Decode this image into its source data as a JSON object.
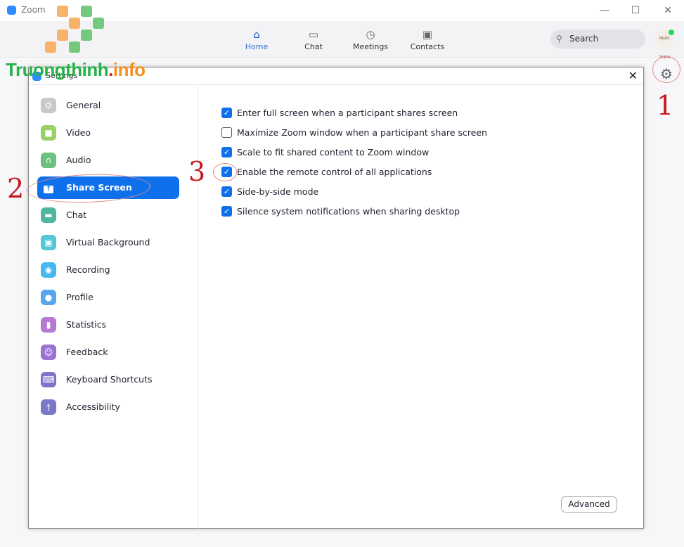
{
  "app": {
    "title": "Zoom",
    "window_controls": [
      "minimize",
      "maximize",
      "close"
    ]
  },
  "nav": {
    "tabs": [
      {
        "label": "Home",
        "icon": "home-icon",
        "active": true
      },
      {
        "label": "Chat",
        "icon": "chat-icon"
      },
      {
        "label": "Meetings",
        "icon": "clock-icon"
      },
      {
        "label": "Contacts",
        "icon": "contacts-icon"
      }
    ],
    "search_placeholder": "Search",
    "avatar_text": "NGOC THIEN"
  },
  "settings": {
    "title": "Settings",
    "sidebar": [
      {
        "label": "General",
        "color": "#c8c8cc",
        "glyph": "⚙"
      },
      {
        "label": "Video",
        "color": "#9ad06a",
        "glyph": "■"
      },
      {
        "label": "Audio",
        "color": "#6cc27c",
        "glyph": "∩"
      },
      {
        "label": "Share Screen",
        "color": "#ffffff",
        "glyph": "↑",
        "active": true
      },
      {
        "label": "Chat",
        "color": "#4fb6a0",
        "glyph": "▬"
      },
      {
        "label": "Virtual Background",
        "color": "#54c6d6",
        "glyph": "▣"
      },
      {
        "label": "Recording",
        "color": "#45b8ee",
        "glyph": "◉"
      },
      {
        "label": "Profile",
        "color": "#58a6f0",
        "glyph": "●"
      },
      {
        "label": "Statistics",
        "color": "#b77ad4",
        "glyph": "▮"
      },
      {
        "label": "Feedback",
        "color": "#9b74d2",
        "glyph": "☺"
      },
      {
        "label": "Keyboard Shortcuts",
        "color": "#8470c8",
        "glyph": "⌨"
      },
      {
        "label": "Accessibility",
        "color": "#7a78c8",
        "glyph": "†"
      }
    ],
    "options": [
      {
        "label": "Enter full screen when a participant shares screen",
        "checked": true
      },
      {
        "label": "Maximize Zoom window when a participant share screen",
        "checked": false
      },
      {
        "label": "Scale to fit shared content to Zoom window",
        "checked": true
      },
      {
        "label": "Enable the remote control of all applications",
        "checked": true
      },
      {
        "label": "Side-by-side mode",
        "checked": true
      },
      {
        "label": "Silence system notifications when sharing desktop",
        "checked": true
      }
    ],
    "advanced_label": "Advanced"
  },
  "annotations": {
    "step1": "1",
    "step2": "2",
    "step3": "3",
    "color": "#c4161c"
  },
  "watermark": {
    "part1": "Truongthinh",
    "dot": ".",
    "part2": "info"
  },
  "colors": {
    "accent": "#0e71eb"
  }
}
